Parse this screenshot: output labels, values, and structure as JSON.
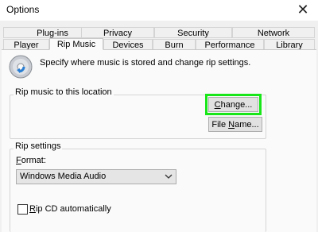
{
  "window": {
    "title": "Options",
    "close_glyph": "✕"
  },
  "tabs": {
    "row1": [
      {
        "label": "Plug-ins"
      },
      {
        "label": "Privacy"
      },
      {
        "label": "Security"
      },
      {
        "label": "Network"
      }
    ],
    "row2": [
      {
        "label": "Player"
      },
      {
        "label": "Rip Music",
        "active": true
      },
      {
        "label": "Devices"
      },
      {
        "label": "Burn"
      },
      {
        "label": "Performance"
      },
      {
        "label": "Library"
      }
    ]
  },
  "content": {
    "description": "Specify where music is stored and change rip settings.",
    "location_group": {
      "title": "Rip music to this location",
      "change_button": {
        "underlined": "C",
        "rest": "hange..."
      },
      "filename_button": {
        "before": "File ",
        "underlined": "N",
        "after": "ame..."
      }
    },
    "rip_settings": {
      "title": "Rip settings",
      "format_label": {
        "underlined": "F",
        "rest": "ormat:"
      },
      "format_value": "Windows Media Audio",
      "rip_cd_label": {
        "underlined": "R",
        "rest": "ip CD automatically"
      },
      "rip_cd_checked": false
    }
  },
  "colors": {
    "highlight": "#19e619",
    "panel": "#fafafa",
    "button": "#e1e1e1"
  },
  "icons": {
    "cd": "cd-rip-icon",
    "close": "close-icon",
    "dropdown": "chevron-down-icon"
  }
}
